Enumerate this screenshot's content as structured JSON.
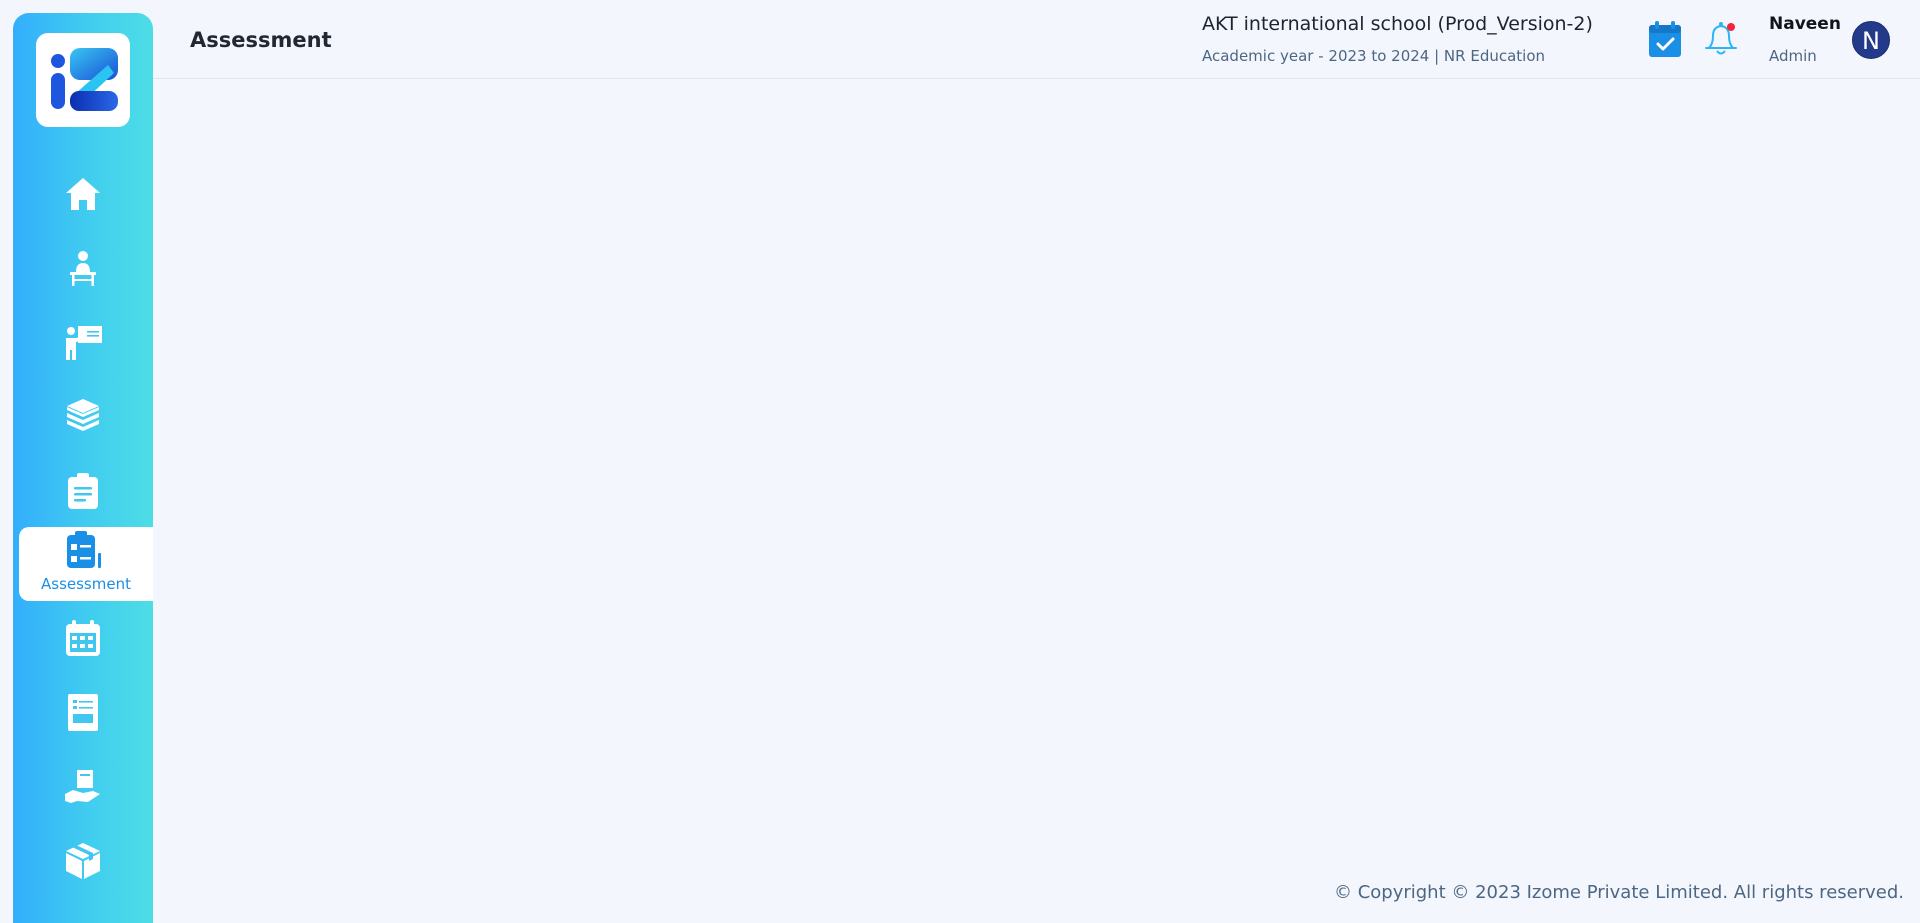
{
  "header": {
    "page_title": "Assessment",
    "school_name": "AKT international school (Prod_Version-2)",
    "academic_year": "Academic year - 2023 to 2024 | NR Education",
    "notification_dot": true
  },
  "user": {
    "name": "Naveen",
    "role": "Admin",
    "avatar_initial": "N"
  },
  "sidebar": {
    "items": [
      {
        "icon": "home-icon",
        "active": false
      },
      {
        "icon": "student-desk-icon",
        "active": false
      },
      {
        "icon": "teacher-board-icon",
        "active": false
      },
      {
        "icon": "books-stack-icon",
        "active": false
      },
      {
        "icon": "clipboard-icon",
        "active": false
      },
      {
        "icon": "assessment-icon",
        "label": "Assessment",
        "active": true
      },
      {
        "icon": "calendar-icon",
        "active": false
      },
      {
        "icon": "question-paper-icon",
        "active": false
      },
      {
        "icon": "hand-book-icon",
        "active": false
      },
      {
        "icon": "box-icon",
        "active": false
      }
    ]
  },
  "footer": {
    "copyright": "© Copyright © 2023 Izome Private Limited. All rights reserved."
  },
  "colors": {
    "sidebar_gradient_start": "#33aefc",
    "sidebar_gradient_end": "#4ddde6",
    "accent": "#1a8fe6",
    "avatar_bg": "#233a8a",
    "page_bg": "#f3f7fd"
  }
}
